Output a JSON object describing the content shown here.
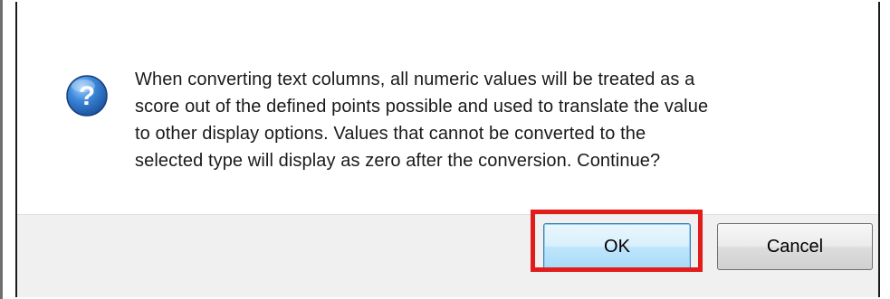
{
  "dialog": {
    "icon": "question-icon",
    "message_lines": [
      "When converting text columns, all numeric values will be treated as a",
      "score out of the defined points possible and used to translate the value",
      "to other display options. Values that cannot be converted to the",
      "selected type will display as zero after the conversion. Continue?"
    ],
    "buttons": {
      "ok_label": "OK",
      "cancel_label": "Cancel"
    }
  },
  "colors": {
    "highlight": "#e21b1b",
    "icon_blue": "#2a6fc2",
    "footer_bg": "#f0f0f0"
  }
}
